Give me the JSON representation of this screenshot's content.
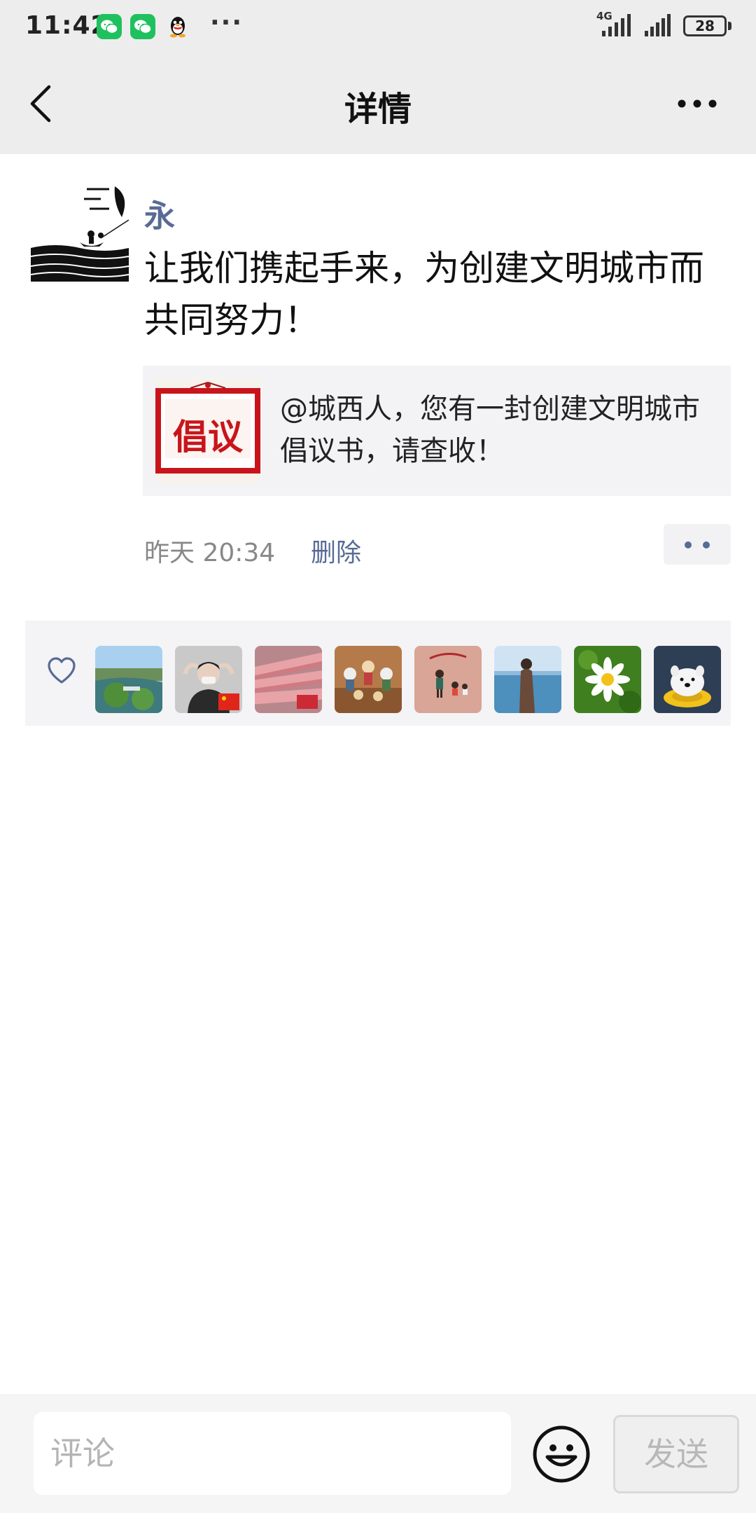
{
  "status_bar": {
    "time": "11:42",
    "network": "4G",
    "battery": "28",
    "icons": [
      "wechat-icon",
      "wechat-icon",
      "qq-icon",
      "more-notifications-icon",
      "signal-icon",
      "battery-icon"
    ]
  },
  "nav": {
    "title": "详情",
    "back_icon": "chevron-left-icon",
    "more_icon": "more-icon"
  },
  "post": {
    "author": "永",
    "text": "让我们携起手来，为创建文明城市而共同努力！",
    "share": {
      "thumb_text": "倡议",
      "text": "@城西人，您有一封创建文明城市倡议书，请查收！"
    },
    "time": "昨天 20:34",
    "delete_label": "删除"
  },
  "likes": {
    "icon": "heart-icon",
    "count_shown": 8
  },
  "comment": {
    "placeholder": "评论",
    "send_label": "发送",
    "emoji_icon": "emoji-icon"
  },
  "colors": {
    "link": "#576b95",
    "bar_bg": "#ededed",
    "wechat_green": "#1fc15e",
    "thumb_red": "#c8151b"
  }
}
